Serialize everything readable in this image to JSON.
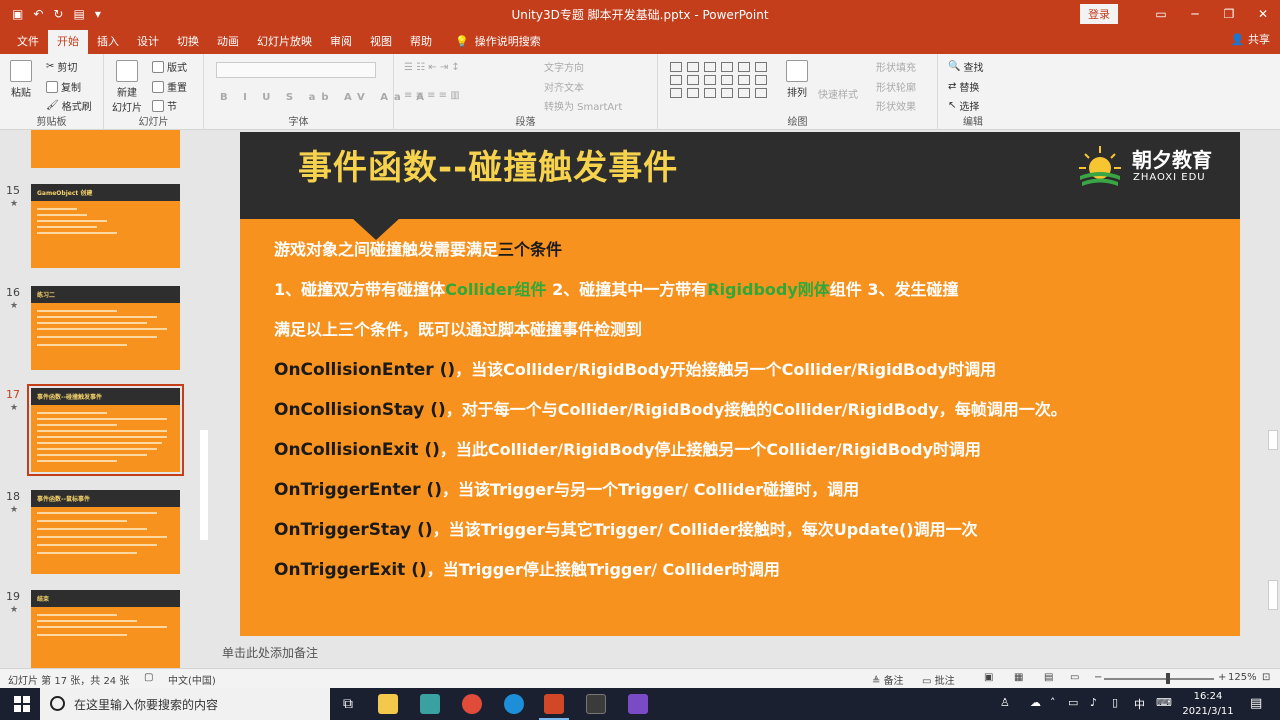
{
  "window": {
    "title": "Unity3D专题 脚本开发基础.pptx - PowerPoint",
    "login": "登录"
  },
  "tabs": [
    "文件",
    "开始",
    "插入",
    "设计",
    "切换",
    "动画",
    "幻灯片放映",
    "审阅",
    "视图",
    "帮助"
  ],
  "tell_me": "操作说明搜索",
  "share": "共享",
  "ribbon": {
    "clipboard": {
      "paste": "粘贴",
      "cut": "剪切",
      "copy": "复制",
      "format_painter": "格式刷",
      "label": "剪贴板"
    },
    "slides": {
      "new_slide_1": "新建",
      "new_slide_2": "幻灯片",
      "layout": "版式",
      "reset": "重置",
      "section": "节",
      "label": "幻灯片"
    },
    "font": {
      "label": "字体"
    },
    "paragraph": {
      "text_direction": "文字方向",
      "align_text": "对齐文本",
      "smartart": "转换为 SmartArt",
      "label": "段落"
    },
    "drawing": {
      "arrange": "排列",
      "quick_styles": "快速样式",
      "fill": "形状填充",
      "outline": "形状轮廓",
      "effects": "形状效果",
      "label": "绘图"
    },
    "editing": {
      "find": "查找",
      "replace": "替换",
      "select": "选择",
      "label": "编辑"
    }
  },
  "thumbnails": [
    {
      "number": "15",
      "title": "GameObject 创建"
    },
    {
      "number": "16",
      "title": "练习二"
    },
    {
      "number": "17",
      "title": "事件函数--碰撞触发事件"
    },
    {
      "number": "18",
      "title": "事件函数--鼠标事件"
    },
    {
      "number": "19",
      "title": "结束"
    }
  ],
  "slide": {
    "title": "事件函数--碰撞触发事件",
    "logo_cn": "朝夕教育",
    "logo_en": "ZHAOXI EDU",
    "intro_a": "游戏对象之间碰撞触发需要满足",
    "intro_b": "三个条件",
    "cond_a": "1、碰撞双方带有碰撞体",
    "cond_b": "Collider组件",
    "cond_c": " 2、碰撞其中一方带有",
    "cond_d": "Rigidbody刚体",
    "cond_e": "组件 3、发生碰撞",
    "summary": "满足以上三个条件，既可以通过脚本碰撞事件检测到",
    "events": [
      {
        "fn": "OnCollisionEnter ()",
        "desc": "，当该Collider/RigidBody开始接触另一个Collider/RigidBody时调用"
      },
      {
        "fn": "OnCollisionStay ()",
        "desc": "，对于每一个与Collider/RigidBody接触的Collider/RigidBody，每帧调用一次。"
      },
      {
        "fn": "OnCollisionExit ()",
        "desc": "，当此Collider/RigidBody停止接触另一个Collider/RigidBody时调用"
      },
      {
        "fn": "OnTriggerEnter ()",
        "desc": "，当该Trigger与另一个Trigger/ Collider碰撞时，调用"
      },
      {
        "fn": "OnTriggerStay ()",
        "desc": "，当该Trigger与其它Trigger/ Collider接触时，每次Update()调用一次"
      },
      {
        "fn": "OnTriggerExit ()",
        "desc": "，当Trigger停止接触Trigger/ Collider时调用"
      }
    ]
  },
  "notes_placeholder": "单击此处添加备注",
  "status": {
    "slide_info": "幻灯片 第 17 张，共 24 张",
    "language": "中文(中国)",
    "notes": "备注",
    "comments": "批注",
    "zoom": "125%"
  },
  "taskbar": {
    "search_placeholder": "在这里输入你要搜索的内容",
    "time": "16:24",
    "date": "2021/3/11",
    "ime": "中"
  },
  "colors": {
    "accent": "#c43e1c",
    "slide_orange": "#f7921e",
    "slide_header": "#2d2d2d",
    "title_yellow": "#f6d24d",
    "green_highlight": "#2fa83a"
  }
}
